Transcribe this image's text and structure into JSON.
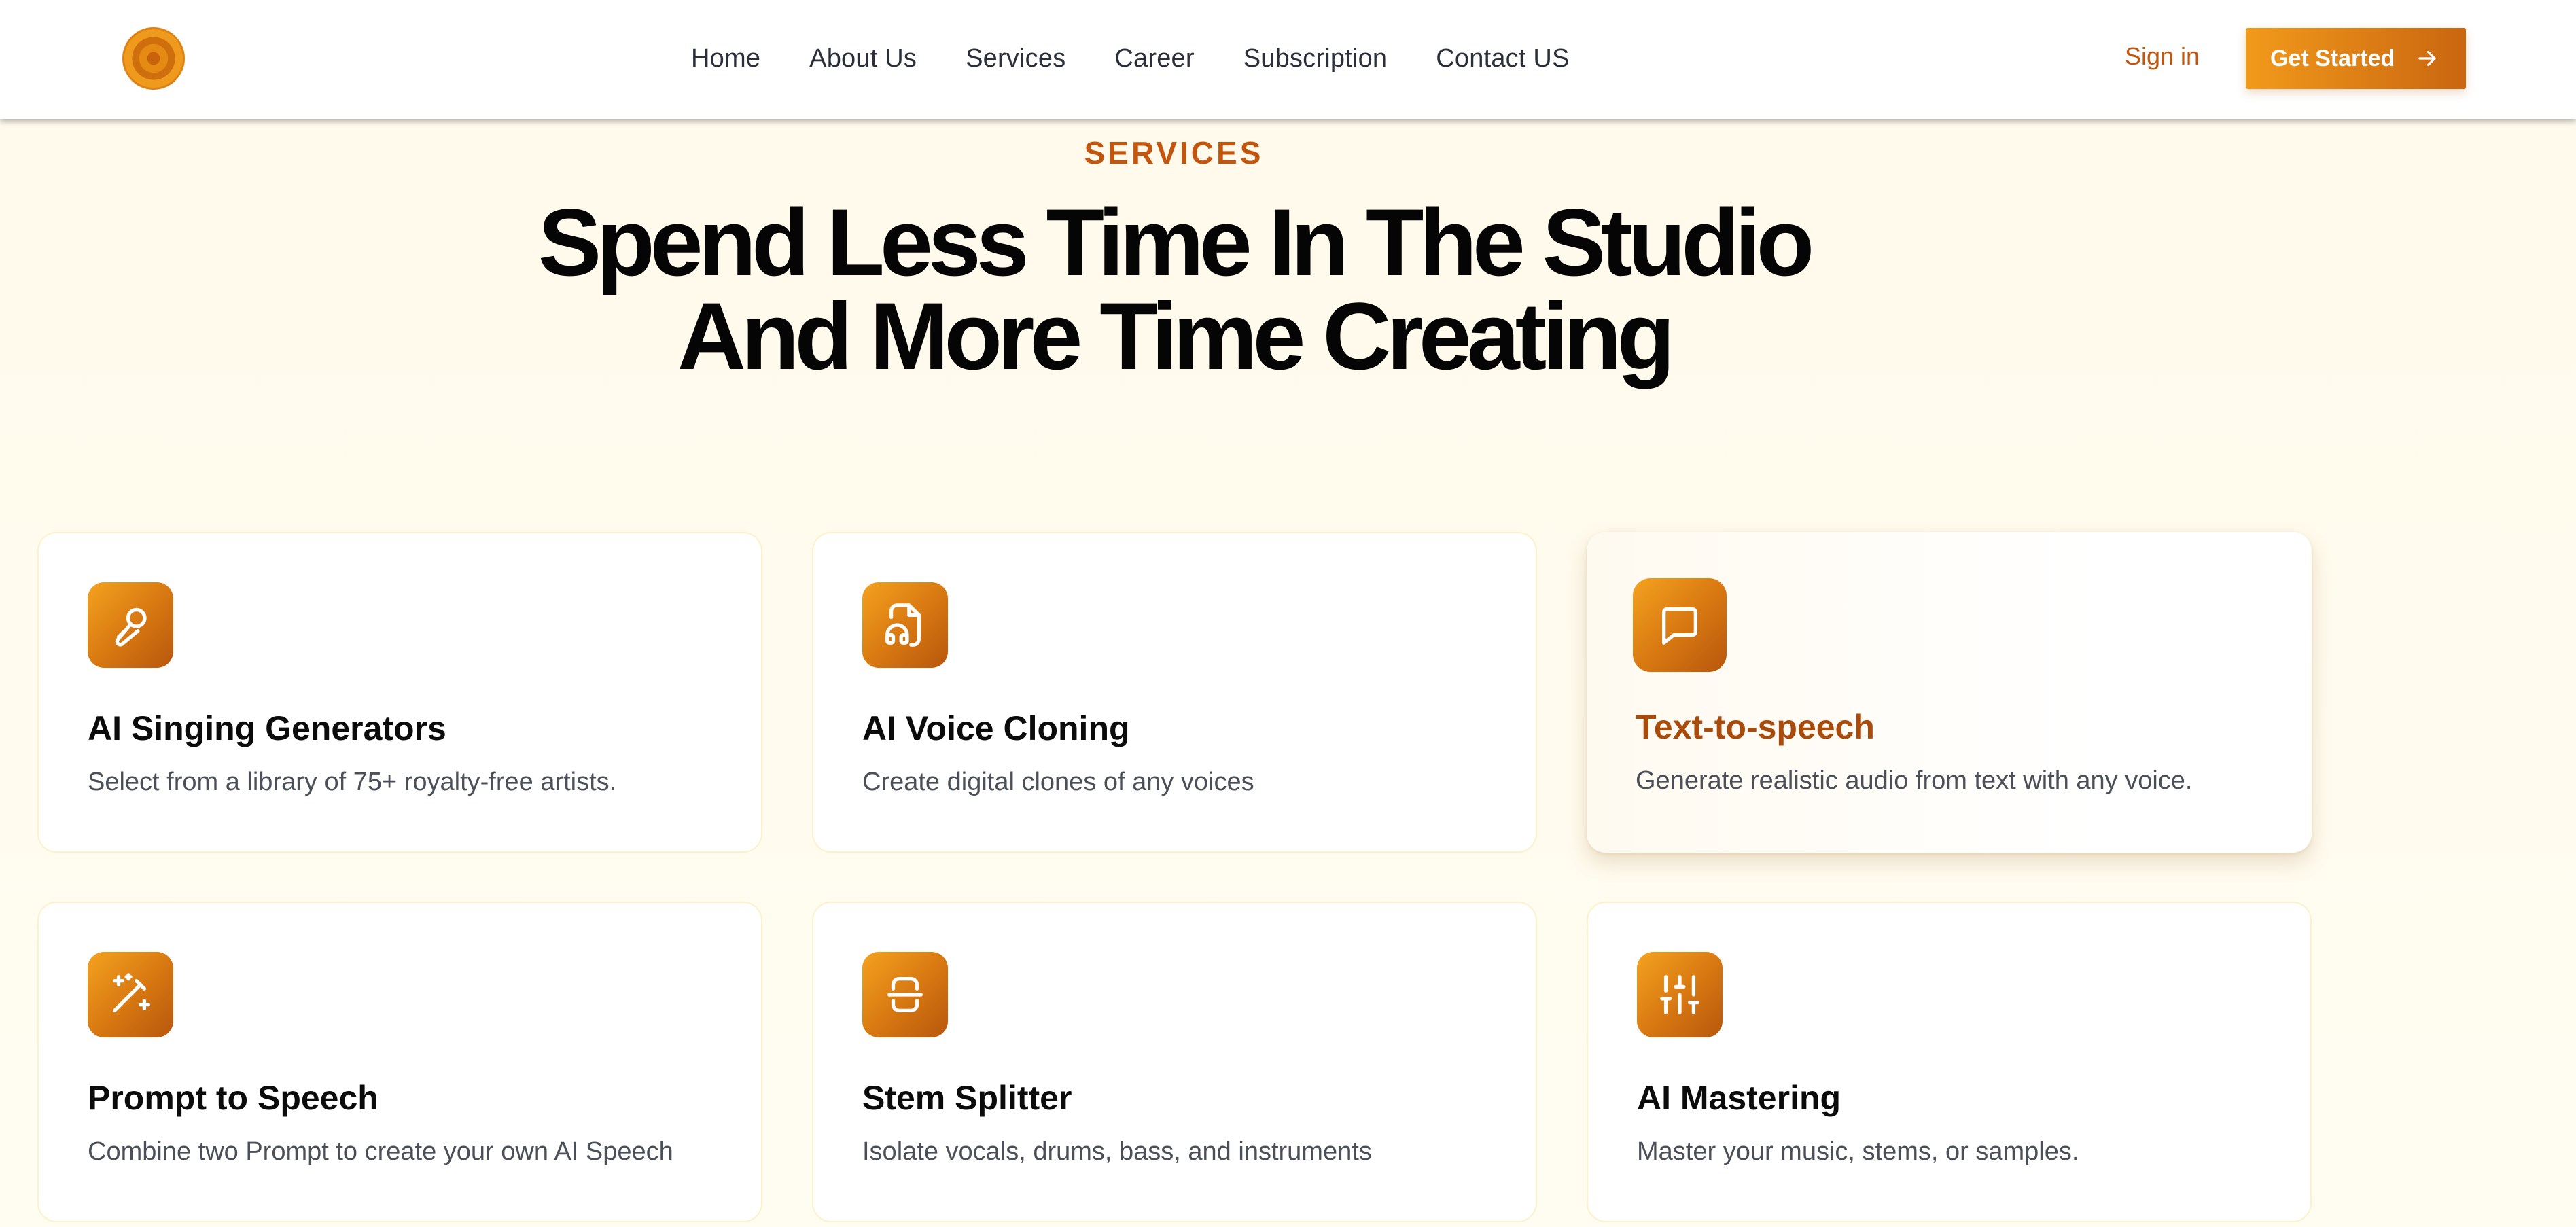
{
  "colors": {
    "accent": "#c2560f",
    "accent_gradient_start": "#f29a1b",
    "accent_gradient_end": "#c96610",
    "page_background": "#fffaeb",
    "heading": "#050505",
    "body_text": "#4a4f58"
  },
  "header": {
    "logo_icon": "disc-logo-icon",
    "nav": [
      {
        "label": "Home"
      },
      {
        "label": "About Us"
      },
      {
        "label": "Services"
      },
      {
        "label": "Career"
      },
      {
        "label": "Subscription"
      },
      {
        "label": "Contact US"
      }
    ],
    "signin_label": "Sign in",
    "cta_label": "Get Started",
    "cta_icon": "arrow-right-icon"
  },
  "hero": {
    "eyebrow": "SERVICES",
    "headline_line1": "Spend Less Time In The Studio",
    "headline_line2": "And More Time Creating"
  },
  "services": [
    {
      "title": "AI Singing Generators",
      "description": "Select from a library of 75+ royalty-free artists.",
      "icon": "microphone-icon"
    },
    {
      "title": "AI Voice Cloning",
      "description": "Create digital clones of any voices",
      "icon": "audio-file-icon"
    },
    {
      "title": "Text-to-speech",
      "description": "Generate realistic audio from text with any voice.",
      "icon": "chat-bubble-icon"
    },
    {
      "title": "Prompt to Speech",
      "description": "Combine two Prompt to create your own AI Speech",
      "icon": "magic-wand-icon"
    },
    {
      "title": "Stem Splitter",
      "description": "Isolate vocals, drums, bass, and instruments",
      "icon": "split-scan-icon"
    },
    {
      "title": "AI Mastering",
      "description": "Master your music, stems, or samples.",
      "icon": "sliders-icon"
    }
  ]
}
